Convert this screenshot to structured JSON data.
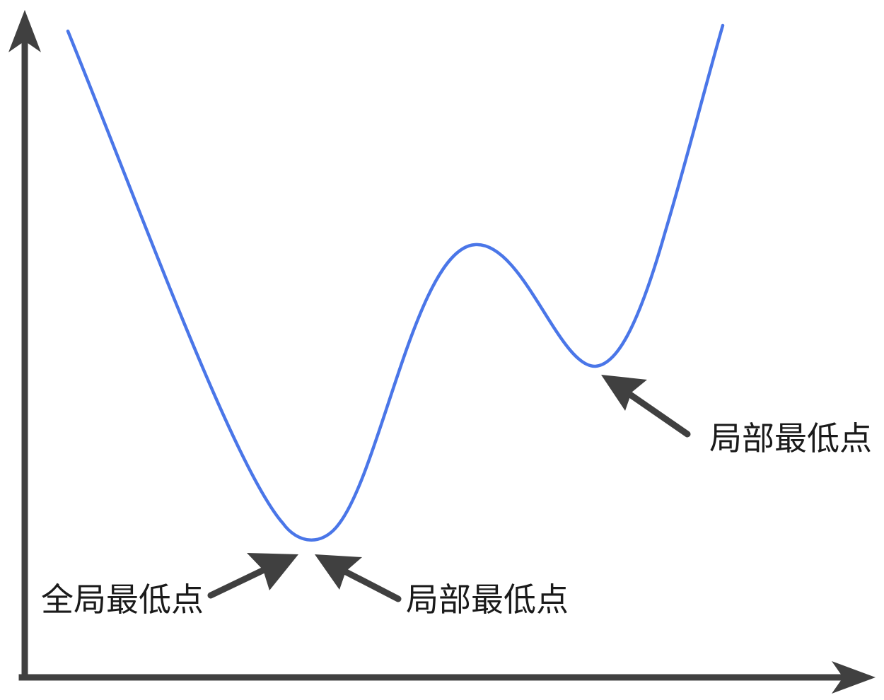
{
  "labels": {
    "global_min": "全局最低点",
    "local_min_center": "局部最低点",
    "local_min_right": "局部最低点"
  },
  "colors": {
    "curve": "#4a76e8",
    "axis": "#404040",
    "arrow": "#404040",
    "text": "#1a1a1a"
  }
}
